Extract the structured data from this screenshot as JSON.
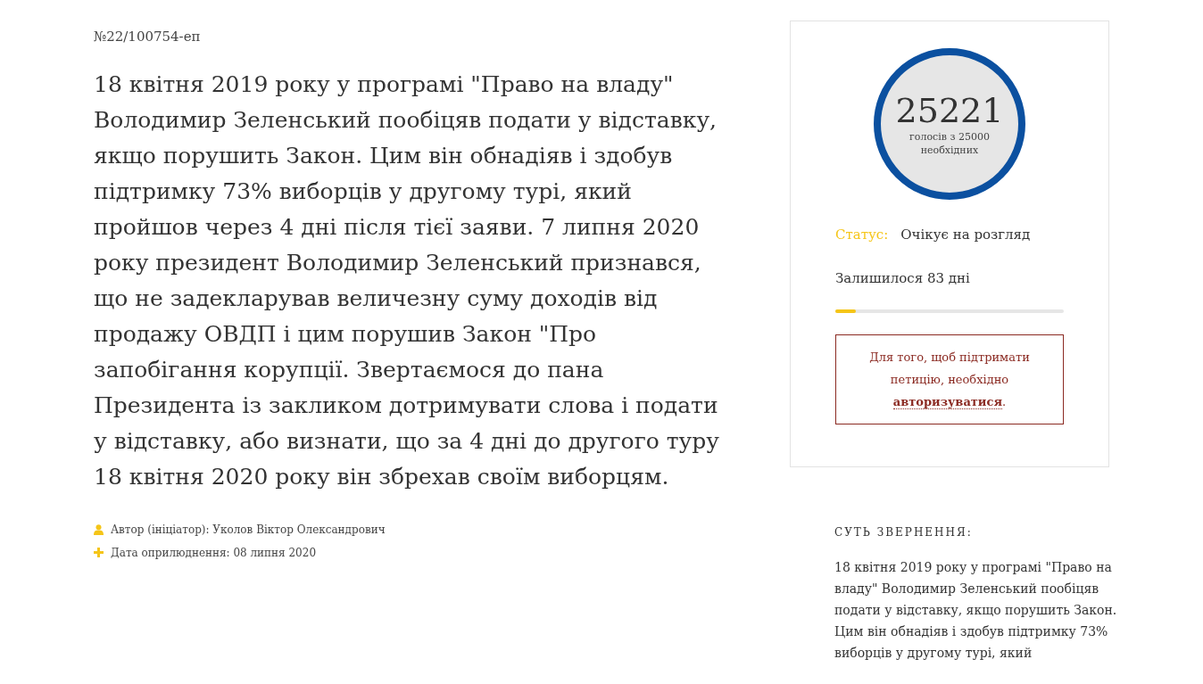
{
  "petition": {
    "number": "№22/100754-еп",
    "text": "18 квітня 2019 року у програмі \"Право на владу\" Володимир Зеленський пообіцяв подати у відставку, якщо порушить Закон. Цим він обнадіяв і здобув підтримку 73% виборців у другому турі, який пройшов через 4 дні після тієї заяви. 7 липня 2020 року президент Володимир Зеленський признався, що не задекларував величезну суму доходів від продажу ОВДП і цим порушив Закон \"Про запобігання корупції. Звертаємося до пана Президента із закликом дотримувати слова і подати у відставку, або визнати, що за 4 дні до другого туру 18 квітня 2020 року він збрехав своїм виборцям.",
    "meta": [
      {
        "kind": "author",
        "text": "Автор (ініціатор): Уколов Віктор Олександрович"
      },
      {
        "kind": "date",
        "text": "Дата оприлюднення: 08 липня 2020"
      }
    ]
  },
  "votes": {
    "count": "25221",
    "caption": "голосів з 25000 необхідних"
  },
  "status": {
    "label": "Статус:",
    "value": "Очікує на розгляд"
  },
  "remaining": {
    "text": "Залишилося 83 дні",
    "level": 0.09
  },
  "auth_notice": {
    "text": "Для того, щоб підтримати петицію, необхідно",
    "link": "авторизуватися",
    "after": "."
  },
  "summary": {
    "heading": "СУТЬ ЗВЕРНЕННЯ:",
    "text": "18 квітня 2019 року у програмі \"Право на владу\" Володимир Зеленський пообіцяв подати у відставку, якщо порушить Закон. Цим він обнадіяв і здобув підтримку 73% виборців у другому турі, який"
  }
}
